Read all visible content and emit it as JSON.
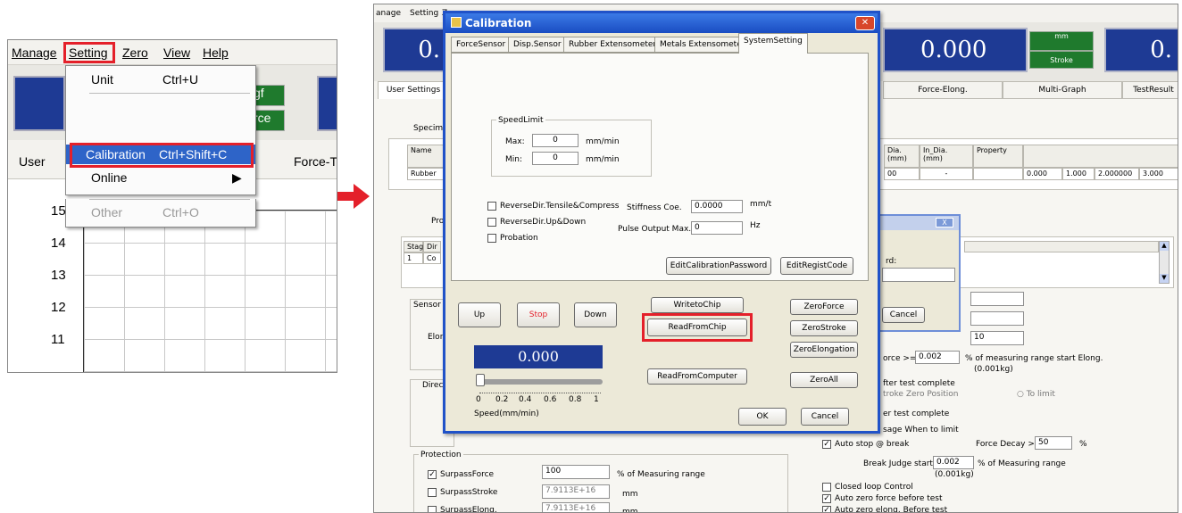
{
  "left": {
    "menu": [
      "Manage",
      "Setting",
      "Zero",
      "View",
      "Help"
    ],
    "dropdown": [
      {
        "label": "Unit",
        "shortcut": "Ctrl+U"
      },
      {
        "label": "Calibration",
        "shortcut": "Ctrl+Shift+C"
      },
      {
        "label": "Online",
        "shortcut": ""
      },
      {
        "label": "Other",
        "shortcut": "Ctrl+O"
      }
    ],
    "green_buttons": [
      "gf",
      "rce"
    ],
    "tabs": [
      "User",
      "Force-T"
    ],
    "y_ticks": [
      "15",
      "14",
      "13",
      "12",
      "11"
    ]
  },
  "right": {
    "menu": [
      "anage",
      "Setting",
      "Z"
    ],
    "displays": {
      "d1": "0.",
      "d2": "0.000",
      "d3": "0."
    },
    "unit": {
      "top": "mm",
      "bottom": "Stroke"
    },
    "main_tabs": [
      "User Settings",
      "Force-Elong.",
      "Multi-Graph",
      "TestResult"
    ],
    "specimen_label": "Specim",
    "table_headers": [
      "Name",
      "Dia.\n(mm)",
      "In_Dia.\n(mm)",
      "Property"
    ],
    "table_row": [
      "Rubber",
      "00",
      "-",
      "0.000",
      "1.000",
      "2.000000",
      "3.000"
    ],
    "proj_label": "Proj",
    "stage_headers": [
      "Stage",
      "Dir"
    ],
    "stage_row": [
      "1",
      "Co"
    ],
    "sensor_label": "Sensor",
    "elon_label": "Elon",
    "direction_label": "Directio",
    "force_start": {
      "prefix": "orce >=",
      "value": "0.002",
      "suffix": "% of measuring range start Elong.",
      "note": "(0.001kg)"
    },
    "after_test": "fter test complete",
    "stroke_zero": "troke Zero Position",
    "to_limit": "To limit",
    "er_test": "er test complete",
    "sage_limit": "sage When to limit",
    "auto_stop": "Auto stop @ break",
    "force_decay": {
      "label": "Force Decay >=:",
      "value": "50",
      "unit": "%"
    },
    "break_judge": {
      "label": "Break Judge start:",
      "value": "0.002",
      "suffix": "% of Measuring range",
      "note": "(0.001kg)"
    },
    "closed_loop": "Closed loop Control",
    "auto_zero_force": "Auto zero force before test",
    "auto_zero_elong": "Auto zero elong. Before test",
    "protection": {
      "title": "Protection",
      "rows": [
        {
          "label": "SurpassForce",
          "value": "100",
          "unit": "% of Measuring range",
          "checked": true
        },
        {
          "label": "SurpassStroke",
          "value": "7.9113E+16",
          "unit": "mm",
          "checked": false
        },
        {
          "label": "SurpassElong.",
          "value": "7.9113E+16",
          "unit": "mm",
          "checked": false
        }
      ]
    },
    "pw_dialog": {
      "label": "rd:",
      "cancel": "Cancel",
      "x": "X"
    },
    "misc_value": "10"
  },
  "dialog": {
    "title": "Calibration",
    "tabs": [
      "ForceSensor",
      "Disp.Sensor",
      "Rubber Extensometer",
      "Metals Extensometer",
      "SystemSetting"
    ],
    "speed_limit": {
      "title": "SpeedLimit",
      "max_label": "Max:",
      "max_value": "0",
      "min_label": "Min:",
      "min_value": "0",
      "unit": "mm/min"
    },
    "checks": [
      "ReverseDir.Tensile&Compress",
      "ReverseDir.Up&Down",
      "Probation"
    ],
    "stiffness": {
      "label": "Stiffness Coe.",
      "value": "0.0000",
      "unit": "mm/t"
    },
    "pulse": {
      "label": "Pulse Output Max.",
      "value": "0",
      "unit": "Hz"
    },
    "buttons": {
      "edit_cal_pw": "EditCalibrationPassword",
      "edit_regist": "EditRegistCode",
      "up": "Up",
      "stop": "Stop",
      "down": "Down",
      "write_chip": "WritetoChip",
      "read_chip": "ReadFromChip",
      "read_computer": "ReadFromComputer",
      "zero_force": "ZeroForce",
      "zero_stroke": "ZeroStroke",
      "zero_elong": "ZeroElongation",
      "zero_all": "ZeroAll",
      "ok": "OK",
      "cancel": "Cancel"
    },
    "speed_display": "0.000",
    "slider_ticks": [
      "0",
      "0.2",
      "0.4",
      "0.6",
      "0.8",
      "1"
    ],
    "speed_label": "Speed(mm/min)"
  },
  "colors": {
    "highlight_red": "#e4202a",
    "display_blue": "#1e3a94",
    "unit_green": "#1f7a2d",
    "title_blue": "#1a4dc2"
  }
}
